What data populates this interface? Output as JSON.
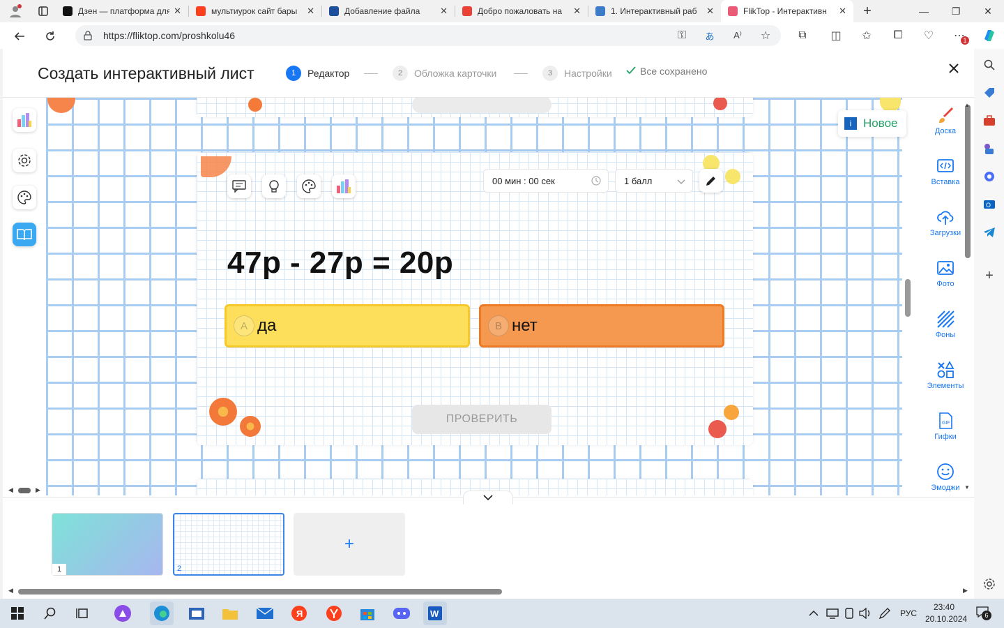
{
  "browser": {
    "tabs": [
      {
        "title": "Дзен — платформа для",
        "color": "#111111"
      },
      {
        "title": "мультиурок сайт бары",
        "color": "#fc3f1d"
      },
      {
        "title": "Добавление файла",
        "color": "#1b4f9c"
      },
      {
        "title": "Добро пожаловать на",
        "color": "#ea4335"
      },
      {
        "title": "1. Интерактивный раб",
        "color": "#3d7cc9"
      },
      {
        "title": "FlikTop - Интерактивн",
        "color": "#e85d75"
      }
    ],
    "url": "https://fliktop.com/proshkolu46",
    "notification_badge": "1"
  },
  "header": {
    "title": "Создать интерактивный лист",
    "steps": [
      {
        "num": "1",
        "label": "Редактор"
      },
      {
        "num": "2",
        "label": "Обложка карточки"
      },
      {
        "num": "3",
        "label": "Настройки"
      }
    ],
    "saved": "Все сохранено"
  },
  "card": {
    "timer": "00 мин : 00 сек",
    "points": "1 балл",
    "question": "47р - 27р = 20р",
    "options": [
      {
        "letter": "A",
        "text": "да",
        "color": "#fddf5c",
        "border": "#f7c928"
      },
      {
        "letter": "B",
        "text": "нет",
        "color": "#f4994f",
        "border": "#ef7a26"
      }
    ],
    "check_label": "ПРОВЕРИТЬ"
  },
  "new_badge": "Новое",
  "right_panel": {
    "items": [
      {
        "label": "Доска",
        "icon": "brush-icon"
      },
      {
        "label": "Вставка",
        "icon": "code-icon"
      },
      {
        "label": "Загрузки",
        "icon": "upload-icon"
      },
      {
        "label": "Фото",
        "icon": "image-icon"
      },
      {
        "label": "Фоны",
        "icon": "stripes-icon"
      },
      {
        "label": "Элементы",
        "icon": "shapes-icon"
      },
      {
        "label": "Гифки",
        "icon": "gif-icon"
      },
      {
        "label": "Эмоджи",
        "icon": "smile-icon"
      }
    ]
  },
  "slides": {
    "thumbnails": [
      {
        "num": "1"
      },
      {
        "num": "2"
      }
    ],
    "add_label": "+"
  },
  "taskbar": {
    "lang": "РУС",
    "time": "23:40",
    "date": "20.10.2024",
    "notifications": "6"
  },
  "colors": {
    "accent": "#1877f2",
    "saved": "#21a366",
    "grid": "#a9cdf2"
  }
}
